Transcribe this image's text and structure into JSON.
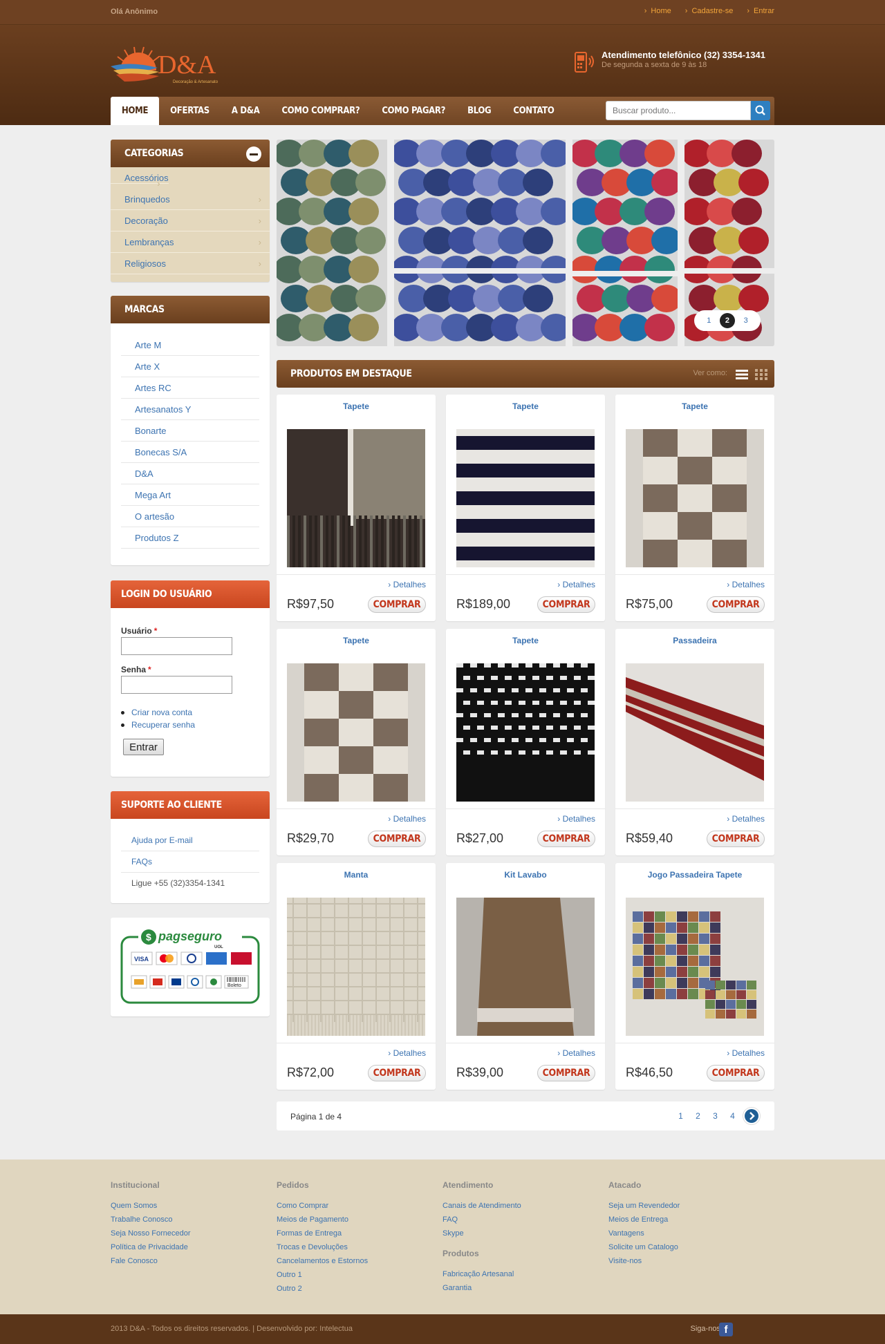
{
  "topbar": {
    "greeting": "Olá Anônimo",
    "links": [
      "Home",
      "Cadastre-se",
      "Entrar"
    ]
  },
  "header": {
    "brand": "D&A",
    "brand_tagline": "Decoração & Artesanato",
    "phone_title": "Atendimento telefônico (32) 3354-1341",
    "phone_sub": "De segunda a sexta de 9 às 18"
  },
  "nav": {
    "items": [
      "HOME",
      "OFERTAS",
      "A D&A",
      "COMO COMPRAR?",
      "COMO PAGAR?",
      "BLOG",
      "CONTATO"
    ],
    "active": "HOME",
    "search_placeholder": "Buscar produto..."
  },
  "categories": {
    "title": "CATEGORIAS",
    "items": [
      "Acessórios",
      "Brinquedos",
      "Decoração",
      "Lembranças",
      "Religiosos"
    ]
  },
  "brands": {
    "title": "MARCAS",
    "items": [
      "Arte M",
      "Arte X",
      "Artes RC",
      "Artesanatos Y",
      "Bonarte",
      "Bonecas S/A",
      "D&A",
      "Mega Art",
      "O artesão",
      "Produtos Z"
    ]
  },
  "login": {
    "title": "LOGIN DO USUÁRIO",
    "user_label": "Usuário",
    "pass_label": "Senha",
    "required_mark": "*",
    "links": [
      "Criar nova conta",
      "Recuperar senha"
    ],
    "button": "Entrar"
  },
  "support": {
    "title": "SUPORTE AO CLIENTE",
    "items": [
      "Ajuda por E-mail",
      "FAQs",
      "Ligue +55 (32)3354-1341"
    ]
  },
  "payment": {
    "brand": "pagseguro",
    "brand_sub": "UOL",
    "cards": [
      "VISA",
      "MasterCard",
      "Diners",
      "Amex",
      "Hipercard"
    ],
    "boleto": "Boleto"
  },
  "slider": {
    "pages": [
      "1",
      "2",
      "3"
    ],
    "active": "2"
  },
  "products": {
    "title": "PRODUTOS EM DESTAQUE",
    "view_as": "Ver como:",
    "details_label": "Detalhes",
    "buy_label": "COMPRAR",
    "items": [
      {
        "name": "Tapete",
        "price": "R$97,50",
        "pattern": "dark-rug"
      },
      {
        "name": "Tapete",
        "price": "R$189,00",
        "pattern": "stripe-rug"
      },
      {
        "name": "Tapete",
        "price": "R$75,00",
        "pattern": "check-rug"
      },
      {
        "name": "Tapete",
        "price": "R$29,70",
        "pattern": "check-rug"
      },
      {
        "name": "Tapete",
        "price": "R$27,00",
        "pattern": "weave-rug"
      },
      {
        "name": "Passadeira",
        "price": "R$59,40",
        "pattern": "red-runner"
      },
      {
        "name": "Manta",
        "price": "R$72,00",
        "pattern": "blanket"
      },
      {
        "name": "Kit Lavabo",
        "price": "R$39,00",
        "pattern": "towel"
      },
      {
        "name": "Jogo Passadeira Tapete",
        "price": "R$46,50",
        "pattern": "multi-rug"
      }
    ]
  },
  "pagination": {
    "info": "Página 1 de 4",
    "pages": [
      "1",
      "2",
      "3",
      "4"
    ]
  },
  "footer": {
    "columns": [
      {
        "title": "Institucional",
        "links": [
          "Quem Somos",
          "Trabalhe Conosco",
          "Seja Nosso Fornecedor",
          "Política de Privacidade",
          "Fale Conosco"
        ]
      },
      {
        "title": "Pedidos",
        "links": [
          "Como Comprar",
          "Meios de Pagamento",
          "Formas de Entrega",
          "Trocas e Devoluções",
          "Cancelamentos e Estornos",
          "Outro 1",
          "Outro 2"
        ]
      },
      {
        "title": "Atendimento",
        "links": [
          "Canais de Atendimento",
          "FAQ",
          "Skype"
        ]
      },
      {
        "title": "Atacado",
        "links": [
          "Seja um Revendedor",
          "Meios de Entrega",
          "Vantagens",
          "Solicite um Catalogo",
          "Visite-nos"
        ]
      }
    ],
    "products_title": "Produtos",
    "products_links": [
      "Fabricação Artesanal",
      "Garantia"
    ],
    "copyright": "2013 D&A - Todos os direitos reservados. | Desenvolvido por: Intelectua",
    "follow": "Siga-nos:"
  },
  "colors": {
    "brown": "#6b3f1f",
    "orange": "#e05a30",
    "link": "#3c73b1",
    "buy": "#c2371d"
  }
}
